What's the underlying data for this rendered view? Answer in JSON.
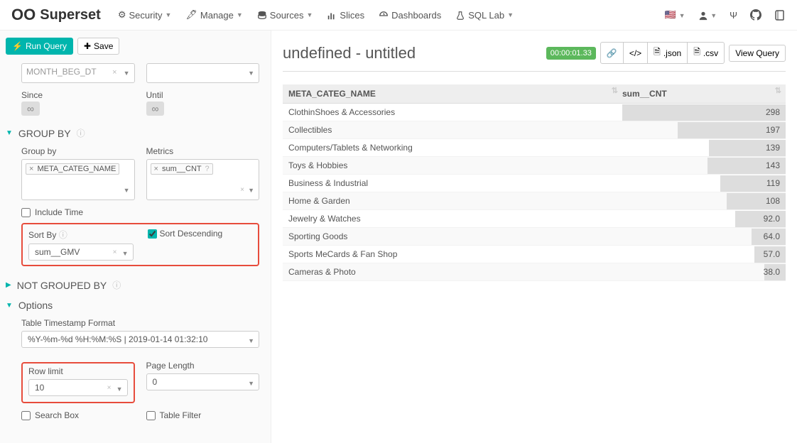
{
  "nav": {
    "brand": "Superset",
    "items": [
      {
        "icon": "gears",
        "label": "Security"
      },
      {
        "icon": "wrench",
        "label": "Manage"
      },
      {
        "icon": "db",
        "label": "Sources"
      },
      {
        "icon": "chart",
        "label": "Slices"
      },
      {
        "icon": "dash",
        "label": "Dashboards"
      },
      {
        "icon": "flask",
        "label": "SQL Lab"
      }
    ],
    "right_icons": [
      "flag-us",
      "user",
      "psi",
      "github",
      "book"
    ]
  },
  "toolbar": {
    "run_label": "Run Query",
    "save_label": "Save"
  },
  "datasource": {
    "value_truncated": "MONTH_BEG_DT",
    "select_placeholder": "",
    "since_label": "Since",
    "until_label": "Until"
  },
  "groupby": {
    "section_title": "GROUP BY",
    "groupby_label": "Group by",
    "groupby_tag": "META_CATEG_NAME",
    "metrics_label": "Metrics",
    "metrics_tag": "sum__CNT",
    "include_time_label": "Include Time",
    "sort_by_label": "Sort By",
    "sort_by_value": "sum__GMV",
    "sort_desc_label": "Sort Descending",
    "sort_desc_checked": true
  },
  "notgrouped": {
    "section_title": "NOT GROUPED BY"
  },
  "options": {
    "section_title": "Options",
    "ts_format_label": "Table Timestamp Format",
    "ts_format_value": "%Y-%m-%d %H:%M:%S | 2019-01-14 01:32:10",
    "row_limit_label": "Row limit",
    "row_limit_value": "10",
    "page_length_label": "Page Length",
    "page_length_value": "0",
    "search_box_label": "Search Box",
    "table_filter_label": "Table Filter"
  },
  "main": {
    "title": "undefined - untitled",
    "timer": "00:00:01.33",
    "btn_json": ".json",
    "btn_csv": ".csv",
    "btn_view_query": "View Query"
  },
  "chart_data": {
    "type": "table",
    "columns": [
      "META_CATEG_NAME",
      "sum__CNT"
    ],
    "rows": [
      {
        "name": "ClothinShoes & Accessories",
        "value": 298,
        "bar_pct": 100
      },
      {
        "name": "Collectibles",
        "value": 197,
        "bar_pct": 66
      },
      {
        "name": "Computers/Tablets & Networking",
        "value": 139,
        "bar_pct": 47
      },
      {
        "name": "Toys & Hobbies",
        "value": 143,
        "bar_pct": 48
      },
      {
        "name": "Business & Industrial",
        "value": 119,
        "bar_pct": 40
      },
      {
        "name": "Home & Garden",
        "value": 108,
        "bar_pct": 36
      },
      {
        "name": "Jewelry & Watches",
        "value": "92.0",
        "bar_pct": 31
      },
      {
        "name": "Sporting Goods",
        "value": "64.0",
        "bar_pct": 21
      },
      {
        "name": "Sports MeCards & Fan Shop",
        "value": "57.0",
        "bar_pct": 19
      },
      {
        "name": "Cameras & Photo",
        "value": "38.0",
        "bar_pct": 13
      }
    ]
  }
}
